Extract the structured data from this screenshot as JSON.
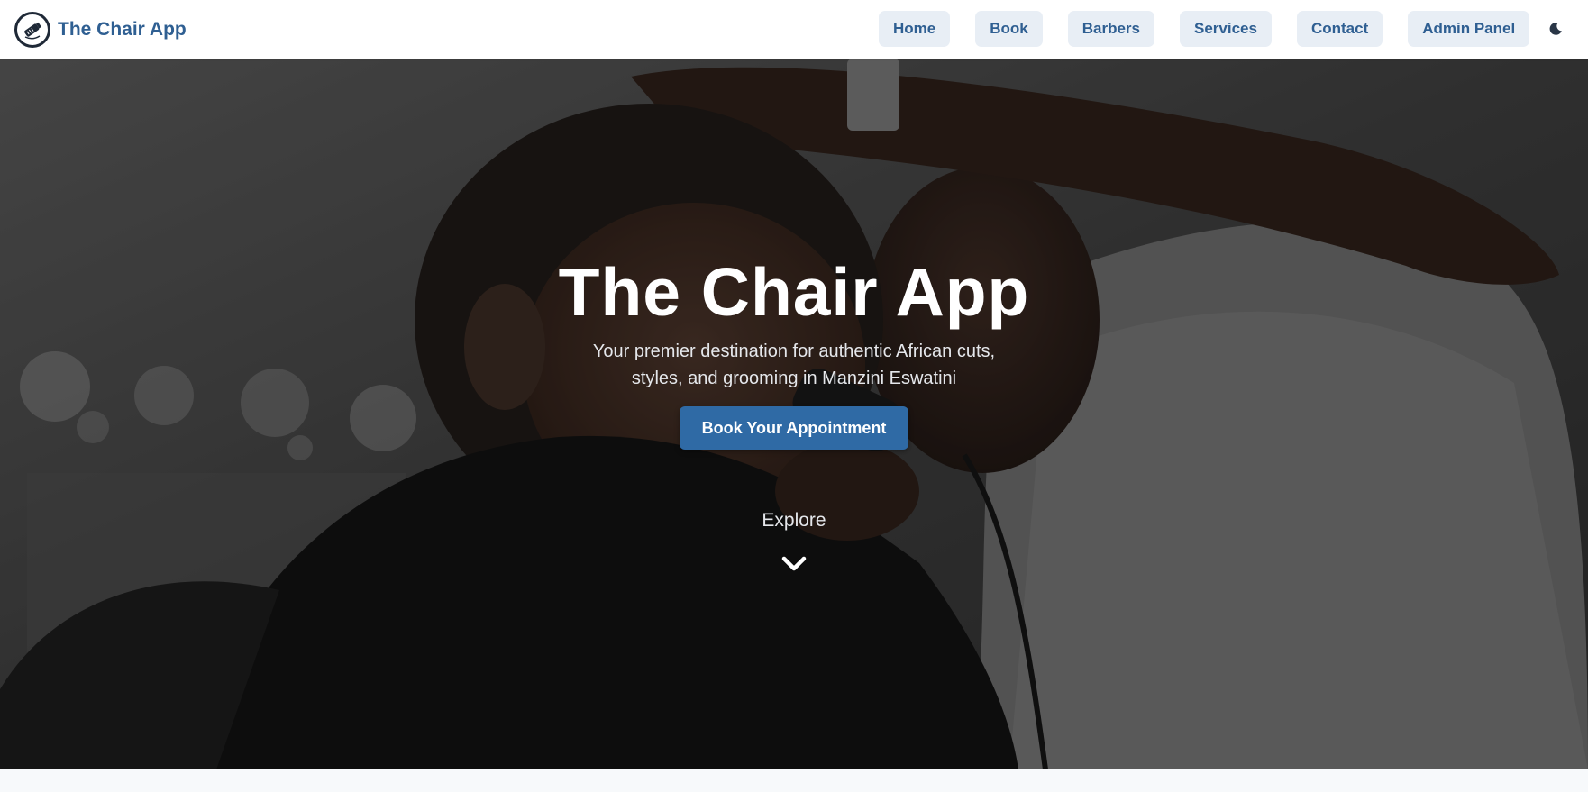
{
  "brand": {
    "name": "The Chair App",
    "logo_icon": "barber-clipper-icon"
  },
  "nav": {
    "items": [
      {
        "label": "Home"
      },
      {
        "label": "Book"
      },
      {
        "label": "Barbers"
      },
      {
        "label": "Services"
      },
      {
        "label": "Contact"
      },
      {
        "label": "Admin Panel"
      }
    ],
    "theme_toggle_icon": "moon-icon"
  },
  "hero": {
    "title": "The Chair App",
    "subtitle": "Your premier destination for authentic African cuts, styles, and grooming in Manzini Eswatini",
    "cta_label": "Book Your Appointment",
    "explore_label": "Explore",
    "explore_icon": "chevron-down-icon",
    "background_image": "barber-cutting-boys-hair-photo"
  },
  "colors": {
    "brand": "#2f5f92",
    "nav_button_bg": "#e8eef5",
    "cta_bg": "#2f6aa5",
    "hero_text": "#ffffff"
  }
}
